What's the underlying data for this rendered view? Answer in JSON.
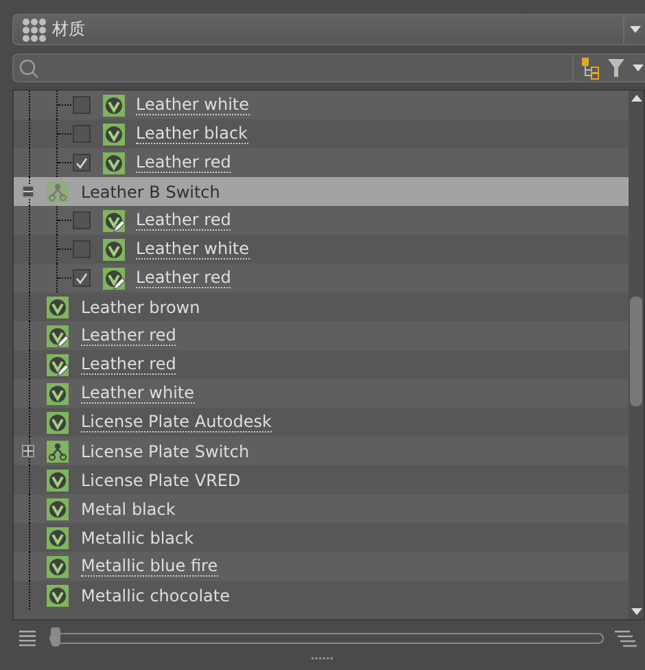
{
  "category_dropdown": {
    "label": "材质"
  },
  "tree": [
    {
      "kind": "variant",
      "label": "Leather white",
      "checked": false,
      "linked": true,
      "edited": false,
      "selected": false
    },
    {
      "kind": "variant",
      "label": "Leather black",
      "checked": false,
      "linked": true,
      "edited": false,
      "selected": false
    },
    {
      "kind": "variant",
      "label": "Leather red",
      "checked": true,
      "linked": true,
      "edited": false,
      "selected": false
    },
    {
      "kind": "switch",
      "label": "Leather B Switch",
      "expanded": true,
      "linked": false,
      "selected": true,
      "children": [
        {
          "kind": "variant",
          "label": "Leather red",
          "checked": false,
          "linked": true,
          "edited": true,
          "selected": false
        },
        {
          "kind": "variant",
          "label": "Leather white",
          "checked": false,
          "linked": true,
          "edited": false,
          "selected": false
        },
        {
          "kind": "variant",
          "label": "Leather red",
          "checked": true,
          "linked": true,
          "edited": true,
          "selected": false
        }
      ]
    },
    {
      "kind": "material",
      "label": "Leather brown",
      "linked": false,
      "edited": false,
      "selected": false
    },
    {
      "kind": "material",
      "label": "Leather red",
      "linked": true,
      "edited": true,
      "selected": false
    },
    {
      "kind": "material",
      "label": "Leather red",
      "linked": true,
      "edited": true,
      "selected": false
    },
    {
      "kind": "material",
      "label": "Leather white",
      "linked": true,
      "edited": false,
      "selected": false
    },
    {
      "kind": "material",
      "label": "License Plate Autodesk",
      "linked": true,
      "edited": false,
      "selected": false
    },
    {
      "kind": "switch",
      "label": "License Plate Switch",
      "expanded": false,
      "linked": false,
      "selected": false
    },
    {
      "kind": "material",
      "label": "License Plate VRED",
      "linked": false,
      "edited": false,
      "selected": false
    },
    {
      "kind": "material",
      "label": "Metal black",
      "linked": false,
      "edited": false,
      "selected": false
    },
    {
      "kind": "material",
      "label": "Metallic black",
      "linked": false,
      "edited": false,
      "selected": false
    },
    {
      "kind": "material",
      "label": "Metallic blue fire",
      "linked": true,
      "edited": false,
      "selected": false
    },
    {
      "kind": "material",
      "label": "Metallic chocolate",
      "linked": false,
      "edited": false,
      "selected": false
    }
  ],
  "size_slider": {
    "level": 0
  }
}
